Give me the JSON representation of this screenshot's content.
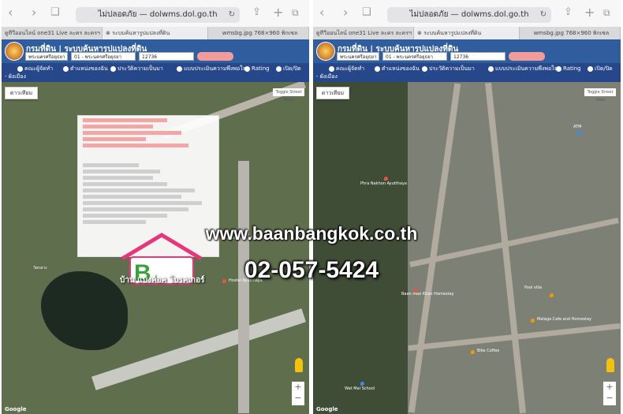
{
  "browser": {
    "url_text": "ไม่ปลอดภัย — dolwms.dol.go.th",
    "tabs": [
      {
        "label": "ดูทีวีออนไลน์ one31 Live ละคร ละครฯ ซีทคอม"
      },
      {
        "label": "ระบบค้นหารูปแปลงที่ดิน"
      },
      {
        "label": "wmsbg.jpg 768×960 พิกเซล"
      }
    ]
  },
  "header": {
    "title": "กรมที่ดิน | ระบบค้นหารูปแปลงที่ดิน"
  },
  "search": {
    "province": "พระนครศรีอยุธยา",
    "district": "01 - พระนครศรีอยุธยา",
    "parcel": "12736"
  },
  "menu": {
    "items": [
      "คณะผู้จัดทำ",
      "ตำแหน่งของฉัน",
      "ประวัติความเป็นมา",
      "แบบประเมินความพึงพอใจ",
      "Rating",
      "เปิด/ปิด"
    ],
    "legend_label": "ผังเมือง"
  },
  "map": {
    "map_type": "ดาวเทียม",
    "street_view": "Toggle Street View",
    "attribution": "Google",
    "zoom_in": "+",
    "zoom_out": "−"
  },
  "left_map_labels": {
    "hostel": "Plus Hostel Ayutthaya",
    "hostel2": "Hostel Ayutthaya",
    "pond": "วัดกลาง"
  },
  "right_map_labels": {
    "homestay": "Baan mae Khan Homestay",
    "pool": "Pool villa",
    "coffee": "Bike Coffee",
    "garden": "Malaga Cafe and Homestay",
    "temple": "Phra Nakhon Ayutthaya",
    "atm": "ATM",
    "school": "Wat Mai School"
  },
  "watermark": {
    "url": "www.baanbangkok.co.th",
    "phone": "02-057-5424",
    "brand": "Baan Bangkok",
    "tagline": "บ้าน แบงค็อค โบรคเกอร์"
  },
  "colors": {
    "header_blue": "#2f5d9e",
    "menu_blue": "#26488a",
    "search_pink": "#f29b9b"
  }
}
